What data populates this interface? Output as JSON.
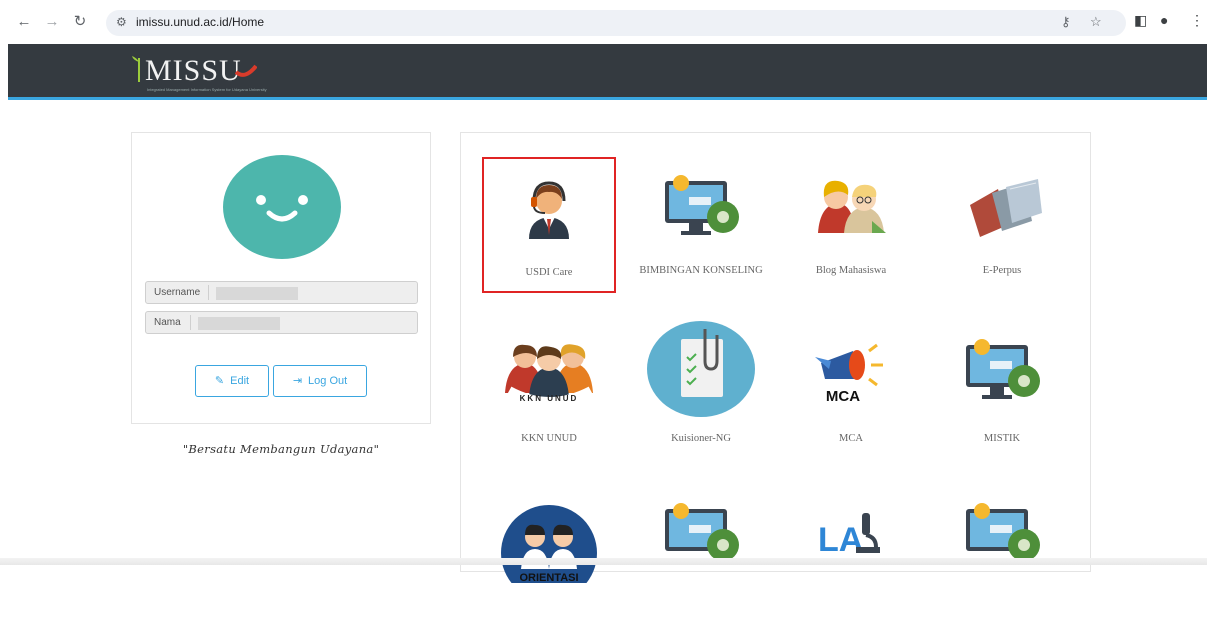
{
  "browser": {
    "url": "imissu.unud.ac.id/Home"
  },
  "header": {
    "logo_text": "MISSU",
    "logo_tagline": "Integrated Management Information System for Udayana University",
    "accent": "#3aa6e0",
    "background": "#343a40"
  },
  "profile": {
    "username_label": "Username",
    "username_value": "",
    "name_label": "Nama",
    "name_value": "",
    "edit_label": "Edit",
    "logout_label": "Log Out",
    "motto": "\"Bersatu Membangun Udayana\""
  },
  "apps": [
    {
      "label": "USDI Care",
      "icon": "headset-person-icon",
      "selected": true
    },
    {
      "label": "BIMBINGAN KONSELING",
      "icon": "monitor-gear-icon"
    },
    {
      "label": "Blog Mahasiswa",
      "icon": "blog-people-icon"
    },
    {
      "label": "E-Perpus",
      "icon": "books-icon"
    },
    {
      "label": "KKN UNUD",
      "icon": "kkn-group-icon",
      "icon_text": "KKN UNUD"
    },
    {
      "label": "Kuisioner-NG",
      "icon": "clipboard-icon"
    },
    {
      "label": "MCA",
      "icon": "megaphone-icon",
      "icon_text": "MCA"
    },
    {
      "label": "MISTIK",
      "icon": "monitor-gear-icon"
    },
    {
      "label": "",
      "icon": "orientasi-icon",
      "icon_text": "ORIENTASI"
    },
    {
      "label": "",
      "icon": "monitor-gear-icon"
    },
    {
      "label": "",
      "icon": "microscope-icon",
      "icon_text": "LA"
    },
    {
      "label": "",
      "icon": "monitor-gear-icon"
    }
  ]
}
